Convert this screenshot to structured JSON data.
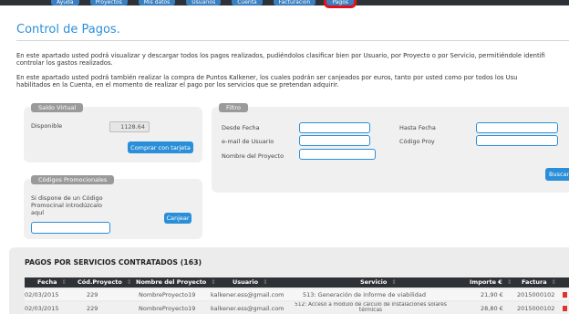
{
  "nav": {
    "items": [
      {
        "label": "Ayuda"
      },
      {
        "label": "Proyectos"
      },
      {
        "label": "Mis datos"
      },
      {
        "label": "Usuarios"
      },
      {
        "label": "Cuenta"
      },
      {
        "label": "Facturación"
      },
      {
        "label": "Pagos"
      }
    ]
  },
  "page": {
    "title": "Control de Pagos.",
    "para1_line1": "En este apartado usted podrá visualizar y descargar todos los pagos realizados, pudiéndolos clasificar bien por Usuario, por Proyecto o por Servicio, permitiéndole identifi",
    "para1_line2": "controlar los gastos realizados.",
    "para2_line1": "En este apartado usted podrá también realizar la compra de Puntos Kalkener, los cuales podrán ser canjeados por euros, tanto por usted como por todos los Usu",
    "para2_line2": "habilitados en la Cuenta, en el momento de realizar el pago por los servicios que se pretendan adquirir."
  },
  "saldo": {
    "title": "Saldo Virtual",
    "disponible_label": "Disponible",
    "disponible_value": "1128.64",
    "buy_button": "Comprar con tarjeta"
  },
  "promo": {
    "title": "Códigos Promocionales",
    "text_line1": "Si dispone de un Código",
    "text_line2": "Promocinal introdúzcalo",
    "text_line3": "aquí",
    "input_value": "",
    "redeem_button": "Canjear"
  },
  "filtro": {
    "title": "Filtro",
    "desde_label": "Desde Fecha",
    "hasta_label": "Hasta Fecha",
    "email_label": "e-mail de Usuario",
    "codigo_label": "Código Proy",
    "nombre_label": "Nombre del Proyecto",
    "search_button": "Buscar"
  },
  "table": {
    "title": "PAGOS POR SERVICIOS CONTRATADOS (163)",
    "headers": {
      "fecha": "Fecha",
      "codigo": "Cód.Proyecto",
      "nombre": "Nombre del Proyecto",
      "usuario": "Usuario",
      "servicio": "Servicio",
      "importe": "Importe €",
      "factura": "Factura"
    },
    "rows": [
      {
        "fecha": "02/03/2015",
        "codigo": "229",
        "nombre": "NombreProyecto19",
        "usuario": "kalkener.ess@gmail.com",
        "servicio": "513: Generación de informe de viabilidad",
        "importe": "21,90 €",
        "factura": "2015000102"
      },
      {
        "fecha": "02/03/2015",
        "codigo": "229",
        "nombre": "NombreProyecto19",
        "usuario": "kalkener.ess@gmail.com",
        "servicio": "512: Acceso a módulo de cálculo de instalaciones solares térmicas",
        "importe": "28,80 €",
        "factura": "2015000102"
      }
    ]
  },
  "colors": {
    "accent": "#2a8fd8",
    "nav_active_outline": "#e3121a",
    "header_dark": "#2e3136"
  }
}
